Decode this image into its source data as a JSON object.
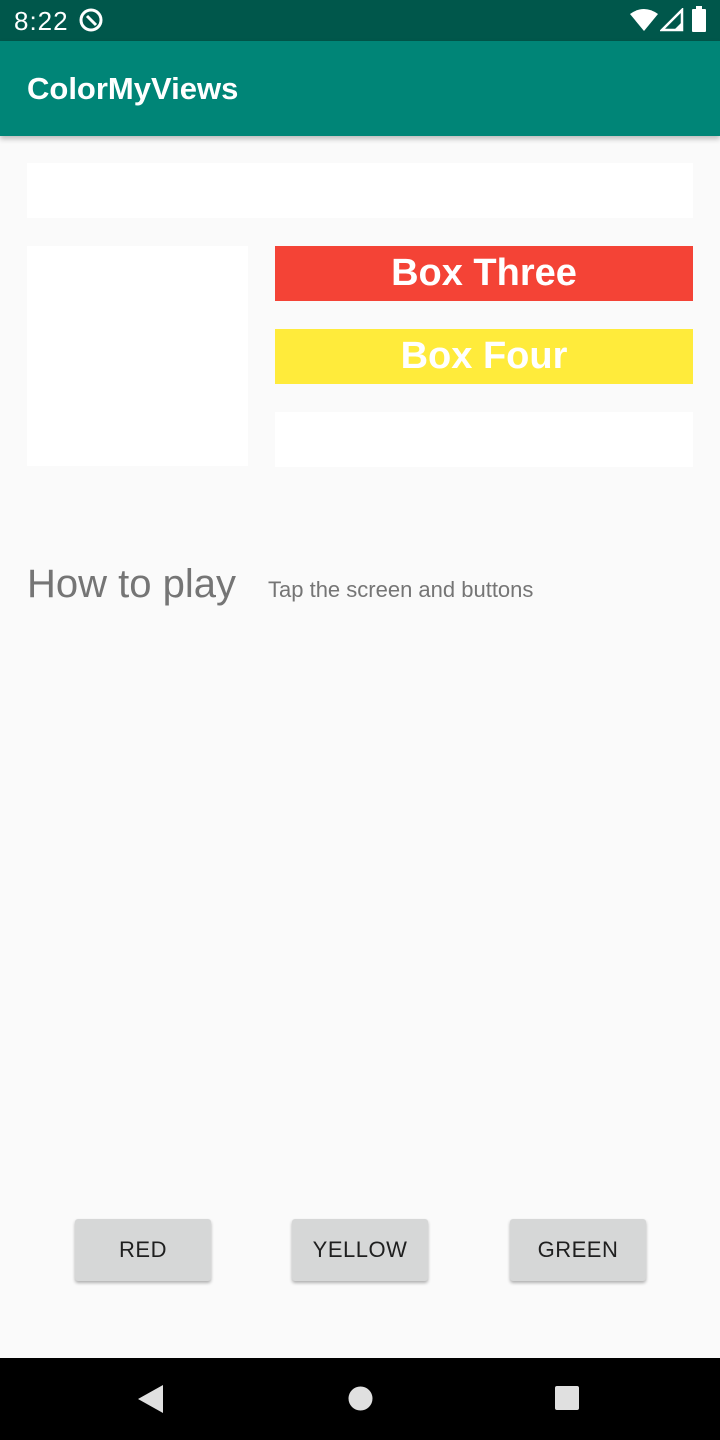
{
  "status_bar": {
    "time": "8:22",
    "icons": [
      "sync-icon",
      "wifi-icon",
      "signal-icon",
      "battery-icon"
    ]
  },
  "app_bar": {
    "title": "ColorMyViews"
  },
  "boxes": {
    "box_one": "",
    "box_two": "",
    "box_three": "Box Three",
    "box_four": "Box Four",
    "box_five": ""
  },
  "how_to_play": {
    "label": "How to play",
    "info": "Tap the screen and buttons"
  },
  "buttons": {
    "red": "RED",
    "yellow": "YELLOW",
    "green": "GREEN"
  },
  "colors": {
    "status_bar": "#00574b",
    "app_bar": "#008577",
    "box_three": "#f44336",
    "box_four": "#ffeb3b",
    "button": "#d6d7d7"
  },
  "nav_bar": {
    "icons": [
      "back-icon",
      "home-icon",
      "recents-icon"
    ]
  }
}
